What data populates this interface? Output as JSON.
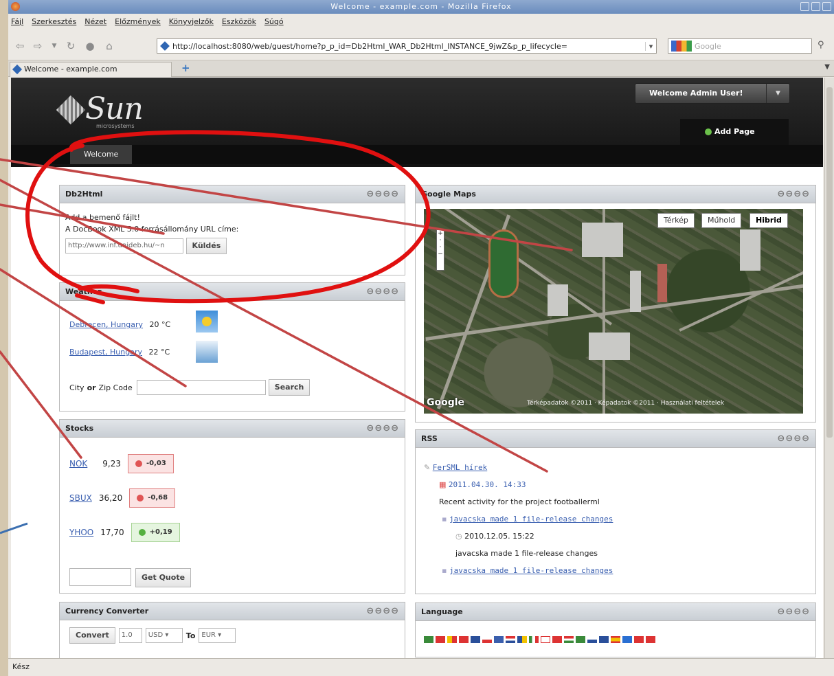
{
  "window": {
    "title": "Welcome - example.com - Mozilla Firefox"
  },
  "menu": [
    "Fájl",
    "Szerkesztés",
    "Nézet",
    "Előzmények",
    "Könyvjelzők",
    "Eszközök",
    "Súgó"
  ],
  "url": "http://localhost:8080/web/guest/home?p_p_id=Db2Html_WAR_Db2Html_INSTANCE_9jwZ&p_p_lifecycle=",
  "search": {
    "placeholder": "Google"
  },
  "tab": {
    "label": "Welcome - example.com"
  },
  "header": {
    "logo_text": "Sun",
    "logo_sub": "microsystems",
    "welcome": "Welcome Admin User!",
    "add_page": "Add Page",
    "nav_tab": "Welcome"
  },
  "db2html": {
    "title": "Db2Html",
    "line1": "Add a bemenő fájlt!",
    "line2": "A DocBook XML 5.0 forrásállomány URL címe:",
    "url_value": "http://www.inf.unideb.hu/~n",
    "submit": "Küldés"
  },
  "weather": {
    "title": "Weather",
    "cities": [
      {
        "name": "Debrecen, Hungary",
        "temp": "20 °C",
        "icon": "sun-icon"
      },
      {
        "name": "Budapest, Hungary",
        "temp": "22 °C",
        "icon": "cloud-icon"
      }
    ],
    "zip_label_1": "City",
    "zip_label_or": "or",
    "zip_label_2": "Zip Code",
    "search": "Search"
  },
  "stocks": {
    "title": "Stocks",
    "rows": [
      {
        "symbol": "NOK",
        "price": "9,23",
        "change": "-0,03",
        "dir": "neg"
      },
      {
        "symbol": "SBUX",
        "price": "36,20",
        "change": "-0,68",
        "dir": "neg"
      },
      {
        "symbol": "YHOO",
        "price": "17,70",
        "change": "+0,19",
        "dir": "pos"
      }
    ],
    "get_quote": "Get Quote"
  },
  "currency": {
    "title": "Currency Converter",
    "convert": "Convert",
    "amount": "1.0",
    "from": "USD",
    "to_label": "To",
    "to": "EUR"
  },
  "maps": {
    "title": "Google Maps",
    "types": [
      "Térkép",
      "Műhold",
      "Hibrid"
    ],
    "active": "Hibrid",
    "attribution": "Térképadatok ©2011 · Képadatok ©2011 · Használati feltételek",
    "logo": "Google"
  },
  "rss": {
    "title": "RSS",
    "feed": "FerSML hírek",
    "date": "2011.04.30. 14:33",
    "desc": "Recent activity for the project footballerml",
    "item1": "javacska made 1 file-release changes",
    "item1_date": "2010.12.05. 15:22",
    "item1_desc": "javacska made 1 file-release changes",
    "item2": "javacska made 1 file-release changes"
  },
  "language": {
    "title": "Language"
  },
  "portlet_controls": "⊖⊖⊖⊖",
  "status": "Kész"
}
